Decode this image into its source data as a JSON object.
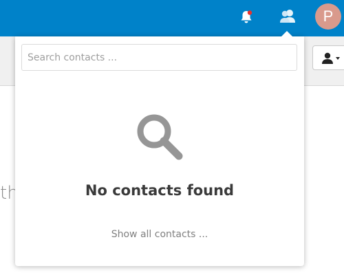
{
  "header": {
    "notifications_icon": "bell-icon",
    "contacts_icon": "contacts-icon",
    "avatar_letter": "P",
    "brand_color": "#0082c9",
    "avatar_color": "#d99a8c",
    "notification_dot_color": "#e9322d"
  },
  "background": {
    "partial_text": "th"
  },
  "contacts_menu": {
    "search_placeholder": "Search contacts ...",
    "empty_icon": "search-icon",
    "empty_title": "No contacts found",
    "show_all_label": "Show all contacts ..."
  }
}
